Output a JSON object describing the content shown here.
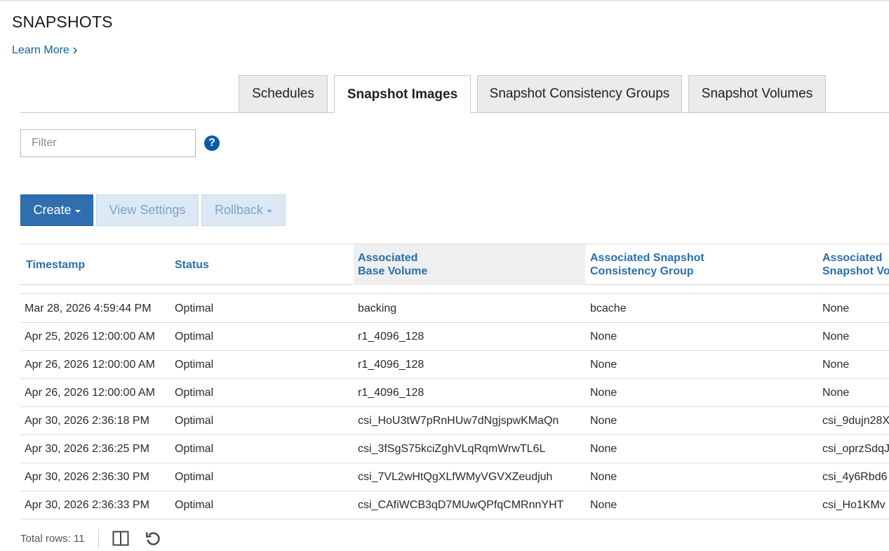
{
  "page": {
    "title": "SNAPSHOTS",
    "learn_more": "Learn More",
    "learn_more_icon": "chevron-right-icon"
  },
  "tabs": [
    {
      "label": "Schedules",
      "active": false
    },
    {
      "label": "Snapshot Images",
      "active": true
    },
    {
      "label": "Snapshot Consistency Groups",
      "active": false
    },
    {
      "label": "Snapshot Volumes",
      "active": false
    }
  ],
  "filter": {
    "placeholder": "Filter",
    "value": ""
  },
  "help_icon": "question-circle-icon",
  "toolbar": {
    "create": "Create",
    "view_settings": "View Settings",
    "rollback": "Rollback"
  },
  "table": {
    "columns": [
      {
        "line1": "Timestamp",
        "line2": ""
      },
      {
        "line1": "Status",
        "line2": ""
      },
      {
        "line1": "Associated",
        "line2": "Base Volume"
      },
      {
        "line1": "Associated Snapshot",
        "line2": "Consistency Group"
      },
      {
        "line1": "Associated",
        "line2": "Snapshot Vo"
      }
    ],
    "rows": [
      [
        "Mar 28, 2026 4:59:44 PM",
        "Optimal",
        "backing",
        "bcache",
        "None"
      ],
      [
        "Apr 25, 2026 12:00:00 AM",
        "Optimal",
        "r1_4096_128",
        "None",
        "None"
      ],
      [
        "Apr 26, 2026 12:00:00 AM",
        "Optimal",
        "r1_4096_128",
        "None",
        "None"
      ],
      [
        "Apr 26, 2026 12:00:00 AM",
        "Optimal",
        "r1_4096_128",
        "None",
        "None"
      ],
      [
        "Apr 30, 2026 2:36:18 PM",
        "Optimal",
        "csi_HoU3tW7pRnHUw7dNgjspwKMaQn",
        "None",
        "csi_9dujn28X"
      ],
      [
        "Apr 30, 2026 2:36:25 PM",
        "Optimal",
        "csi_3fSgS75kciZghVLqRqmWrwTL6L",
        "None",
        "csi_oprzSdqJ"
      ],
      [
        "Apr 30, 2026 2:36:30 PM",
        "Optimal",
        "csi_7VL2wHtQgXLfWMyVGVXZeudjuh",
        "None",
        "csi_4y6Rbd6"
      ],
      [
        "Apr 30, 2026 2:36:33 PM",
        "Optimal",
        "csi_CAfiWCB3qD7MUwQPfqCMRnnYHT",
        "None",
        "csi_Ho1KMv"
      ]
    ]
  },
  "footer": {
    "total_rows": "Total rows: 11",
    "icons": [
      "column-toggle-icon",
      "refresh-icon"
    ]
  },
  "colors": {
    "accent": "#2f6fb0",
    "link": "#0f5fa8",
    "header_text": "#2a6fae"
  }
}
